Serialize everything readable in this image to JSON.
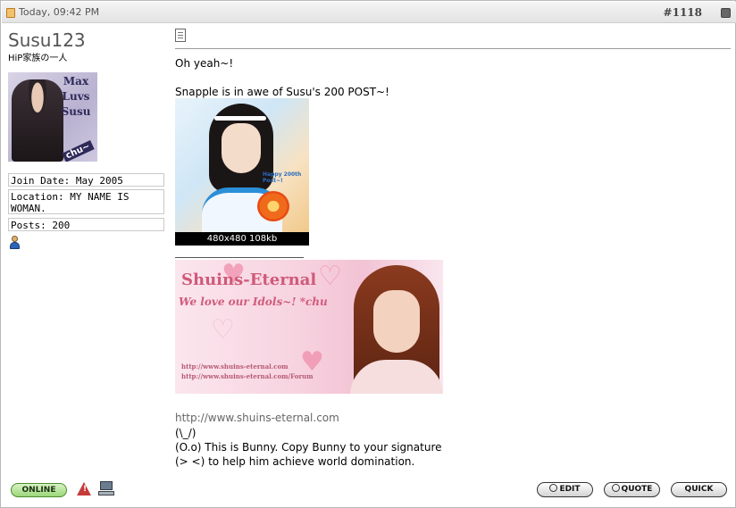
{
  "post": {
    "date": "Today, 09:42 PM",
    "number": "#1118"
  },
  "user": {
    "name": "Susu123",
    "title": "HiP家族の一人",
    "avatar_text": [
      "Max",
      "Luvs",
      "Susu"
    ],
    "avatar_tag": "chu~",
    "join_date": "Join Date: May 2005",
    "location": "Location: MY NAME IS WOMAN.",
    "posts": "Posts: 200"
  },
  "message": {
    "line1": "Oh yeah~!",
    "line2": "Snapple is in awe of Susu's 200 POST~!",
    "image_caption": "480x480 108kb",
    "image_inner_text": "Happy 200th Post~!"
  },
  "signature": {
    "banner_title": "Shuins-Eternal",
    "banner_tagline": "We love our Idols~! *chu",
    "banner_url1": "http://www.shuins-eternal.com",
    "banner_url2": "http://www.shuins-eternal.com/Forum",
    "url": "http://www.shuins-eternal.com",
    "bunny_ears": "(\\_/)",
    "bunny_face": "(O.o) This is Bunny. Copy Bunny to your signature",
    "bunny_hands": "(> <) to help him achieve world domination."
  },
  "footer": {
    "online_label": "ONLINE",
    "edit_label": "EDIT",
    "quote_label": "QUOTE",
    "quick_label": "QUICK"
  }
}
